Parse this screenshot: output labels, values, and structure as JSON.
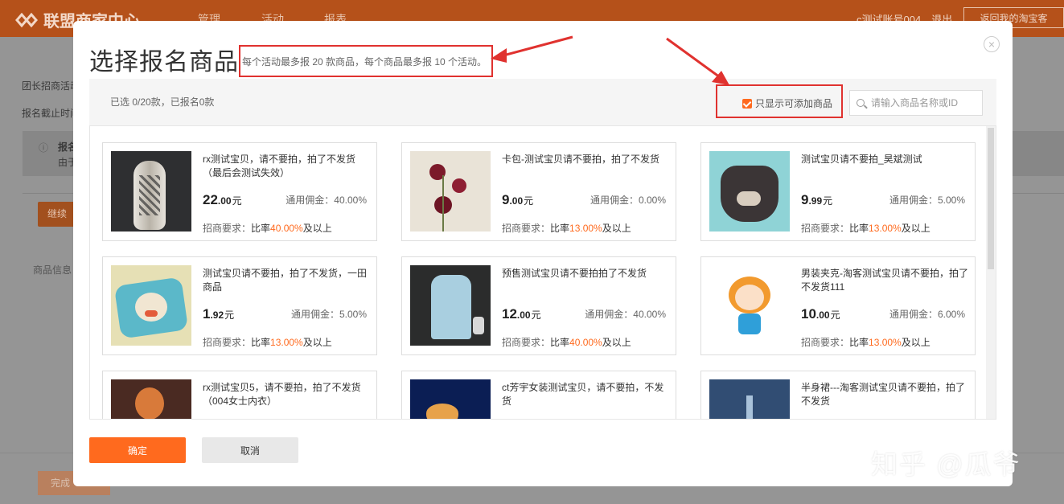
{
  "app": {
    "logo_text": "联盟商家中心",
    "nav": [
      "管理",
      "活动",
      "报表"
    ],
    "account": "c测试账号004，退出",
    "back_button": "返回我的淘宝客"
  },
  "background": {
    "line1": "团长招商活动",
    "line2": "报名截止时间",
    "notice_line1": "报名",
    "notice_line2": "由于",
    "continue_button": "继续",
    "goods_info": "商品信息",
    "finish_button": "完成"
  },
  "modal": {
    "title": "选择报名商品",
    "subtitle": "每个活动最多报 20 款商品，每个商品最多报 10 个活动。",
    "close_glyph": "×",
    "selected_count": "已选 0/20款，已报名0款",
    "filter_label": "只显示可添加商品",
    "search_placeholder": "请输入商品名称或ID",
    "confirm_button": "确定",
    "cancel_button": "取消"
  },
  "labels": {
    "commission_prefix": "通用佣金：",
    "requirement_prefix": "招商要求：",
    "rate_word": "比率",
    "rate_suffix": "及以上",
    "currency": "元"
  },
  "products": [
    {
      "name": "rx测试宝贝，请不要拍，拍了不发货（最后会测试失效）",
      "price_int": "22",
      "price_dec": ".00",
      "commission": "40.00%",
      "rate": "40.00%",
      "image": "vase-image"
    },
    {
      "name": "卡包-测试宝贝请不要拍，拍了不发货",
      "price_int": "9",
      "price_dec": ".00",
      "commission": "0.00%",
      "rate": "13.00%",
      "image": "flower-image"
    },
    {
      "name": "测试宝贝请不要拍_昊斌测试",
      "price_int": "9",
      "price_dec": ".99",
      "commission": "5.00%",
      "rate": "13.00%",
      "image": "bear-tissue-image"
    },
    {
      "name": "测试宝贝请不要拍，拍了不发货，一田商品",
      "price_int": "1",
      "price_dec": ".92",
      "commission": "5.00%",
      "rate": "13.00%",
      "image": "penguin-tissue-image"
    },
    {
      "name": "预售测试宝贝请不要拍拍了不发货",
      "price_int": "12",
      "price_dec": ".00",
      "commission": "40.00%",
      "rate": "40.00%",
      "image": "jacket-image"
    },
    {
      "name": "男装夹克-淘客测试宝贝请不要拍，拍了不发货111",
      "price_int": "10",
      "price_dec": ".00",
      "commission": "6.00%",
      "rate": "13.00%",
      "image": "cartoon-girl-image"
    },
    {
      "name": "rx测试宝贝5，请不要拍，拍了不发货（004女士内衣）",
      "price_int": "",
      "price_dec": "",
      "commission": "",
      "rate": "",
      "image": "anime-image"
    },
    {
      "name": "ct芳宇女装测试宝贝，请不要拍，不发货",
      "price_int": "",
      "price_dec": "",
      "commission": "",
      "rate": "",
      "image": "jellyfish-image"
    },
    {
      "name": "半身裙---淘客测试宝贝请不要拍，拍了不发货",
      "price_int": "",
      "price_dec": "",
      "commission": "",
      "rate": "",
      "image": "night-sky-image"
    }
  ],
  "watermark": "知乎 @瓜爷",
  "colors": {
    "accent": "#ff6a1e",
    "annotation_red": "#e0322f",
    "topbar": "#b5511a"
  }
}
